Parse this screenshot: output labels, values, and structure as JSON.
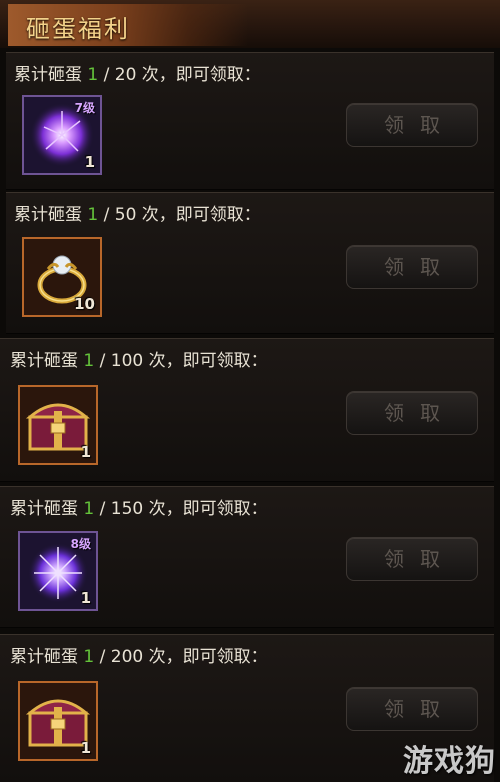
{
  "header": {
    "title": "砸蛋福利"
  },
  "rows": [
    {
      "prefix": "累计砸蛋 ",
      "count": "1",
      "suffix": " / 20 次，即可领取：",
      "item": {
        "icon": "purple-gem-icon",
        "level": "7级",
        "qty": "1"
      },
      "button": "领取"
    },
    {
      "prefix": "累计砸蛋 ",
      "count": "1",
      "suffix": " / 50 次，即可领取：",
      "item": {
        "icon": "gold-ring-icon",
        "level": "",
        "qty": "10"
      },
      "button": "领取"
    },
    {
      "prefix": "累计砸蛋 ",
      "count": "1",
      "suffix": " / 100 次，即可领取：",
      "item": {
        "icon": "treasure-chest-icon",
        "level": "",
        "qty": "1"
      },
      "button": "领取"
    },
    {
      "prefix": "累计砸蛋 ",
      "count": "1",
      "suffix": " / 150 次，即可领取：",
      "item": {
        "icon": "purple-gem-icon",
        "level": "8级",
        "qty": "1"
      },
      "button": "领取"
    },
    {
      "prefix": "累计砸蛋 ",
      "count": "1",
      "suffix": " / 200 次，即可领取：",
      "item": {
        "icon": "treasure-chest-icon",
        "level": "",
        "qty": "1"
      },
      "button": "领取"
    }
  ],
  "watermark": "游戏狗",
  "colors": {
    "count": "#64c23a",
    "title": "#f3d28a",
    "item_border": "#b8672a"
  }
}
